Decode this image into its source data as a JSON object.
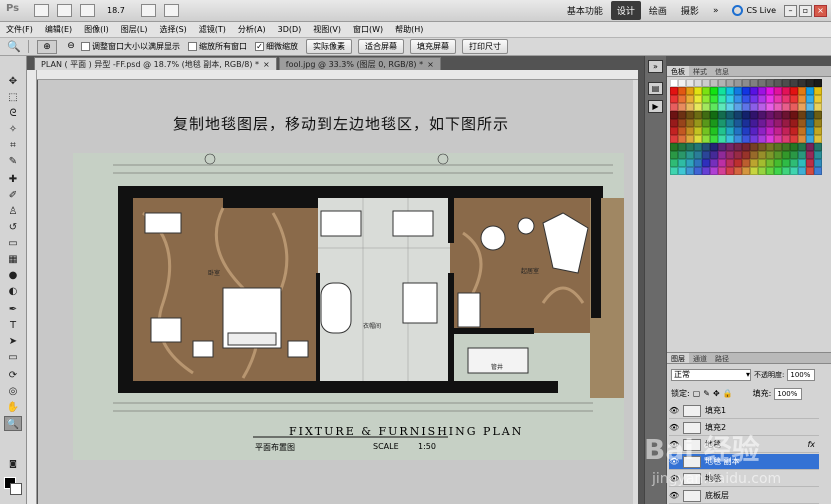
{
  "topbar": {
    "app_icon": "Ps",
    "zoom_value": "18.7",
    "workspaces": [
      "基本功能",
      "设计",
      "绘画",
      "摄影"
    ],
    "active_workspace": "设计",
    "more": "»",
    "cslive": "CS Live"
  },
  "menubar": {
    "items": [
      "文件(F)",
      "编辑(E)",
      "图像(I)",
      "图层(L)",
      "选择(S)",
      "滤镜(T)",
      "分析(A)",
      "3D(D)",
      "视图(V)",
      "窗口(W)",
      "帮助(H)"
    ]
  },
  "options": {
    "resize_windows": "调整窗口大小以满屏显示",
    "zoom_all": "缩放所有窗口",
    "scrubby_zoom": "细微缩放",
    "scrubby_checked": true,
    "actual_pixels": "实际像素",
    "fit_screen": "适合屏幕",
    "fill_screen": "填充屏幕",
    "print_size": "打印尺寸"
  },
  "tabs": [
    {
      "label": "PLAN ( 平面 ) 异型 -FF.psd @ 18.7% (地毯 副本, RGB/8) *",
      "active": true
    },
    {
      "label": "fool.jpg @ 33.3% (图层 0, RGB/8) *",
      "active": false
    }
  ],
  "canvas": {
    "headline": "复制地毯图层，移动到左边地毯区，如下图所示",
    "plan_title": "FIXTURE  &  FURNISHING  PLAN",
    "plan_subtitle": "平面布置图",
    "scale_label": "SCALE",
    "scale_value": "1:50",
    "room_labels": [
      "卧室",
      "衣帽间",
      "起居室",
      "管井"
    ]
  },
  "panels": {
    "swatch_tabs": [
      "色板",
      "样式",
      "信息"
    ],
    "layers_tabs": [
      "图层",
      "通道",
      "路径"
    ],
    "blend_mode": "正常",
    "opacity_label": "不透明度:",
    "opacity_value": "100%",
    "lock_label": "锁定:",
    "fill_label": "填充:",
    "fill_value": "100%",
    "layers": [
      {
        "name": "填充1",
        "selected": false
      },
      {
        "name": "填充2",
        "selected": false
      },
      {
        "name": "地毯",
        "selected": false
      },
      {
        "name": "地毯 副本",
        "selected": true
      },
      {
        "name": "地毯",
        "selected": false
      },
      {
        "name": "底板层",
        "selected": false
      }
    ],
    "watermark": "Bai 经验",
    "watermark_url": "jingyan.baidu.com"
  },
  "colors": {
    "selection": "#3472d4",
    "carpet": "#8a6a4a",
    "wall": "#111111",
    "marble": "#d9dcd8"
  }
}
